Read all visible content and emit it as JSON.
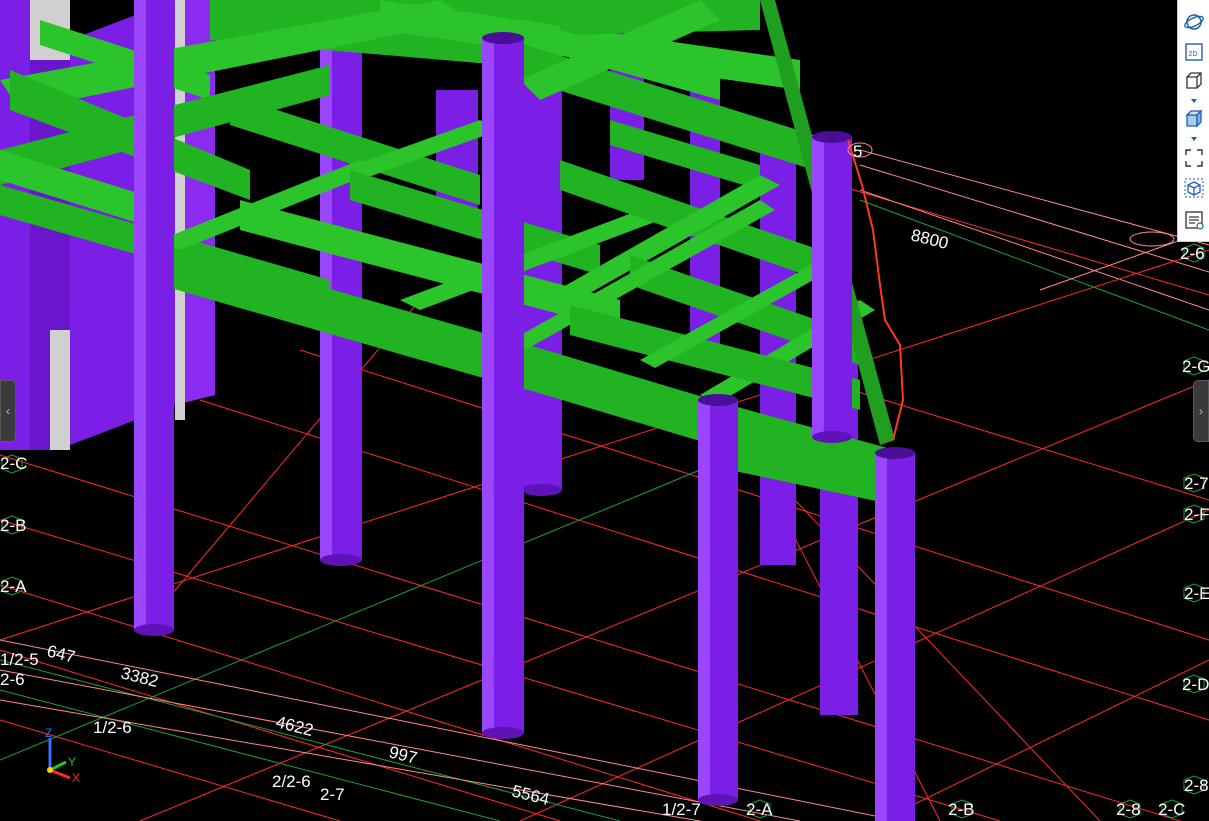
{
  "viewport": {
    "colors": {
      "background": "#000000",
      "column": "#7b1ee6",
      "beam": "#22b322",
      "grid_red": "#ff2a2a",
      "grid_green": "#1f9e3a",
      "grid_pink": "#ff8a8a",
      "measure_line": "#ff3a1a"
    },
    "grid_labels": {
      "l1": "2-6",
      "l2": "2-G",
      "l3": "2-7",
      "l4": "2-F",
      "l5": "2-E",
      "l6": "2-D",
      "l7": "2-8",
      "l8": "2-C",
      "l9": "2-B",
      "l10": "2-A",
      "l11": "1/2-5",
      "l12": "2-6",
      "l13": "1/2-6",
      "l14": "2/2-6",
      "l15": "2-7",
      "l16": "1/2-7",
      "l17": "2-A",
      "l18": "2-B",
      "l19": "2-8",
      "l20": "2-C",
      "l21": "5"
    },
    "dimensions": {
      "d1": "8800",
      "d2": "647",
      "d3": "3382",
      "d4": "4622",
      "d5": "997",
      "d6": "5564"
    },
    "axis": {
      "x": "X",
      "y": "Y",
      "z": "Z"
    }
  },
  "toolbar": {
    "buttons": [
      {
        "id": "orbit",
        "icon": "orbit-icon"
      },
      {
        "id": "2d",
        "icon": "2d-view-icon",
        "label": "2D"
      },
      {
        "id": "3d-box",
        "icon": "3d-box-icon"
      },
      {
        "id": "shaded-box",
        "icon": "shaded-box-icon"
      },
      {
        "id": "fit",
        "icon": "fit-view-icon"
      },
      {
        "id": "section-box",
        "icon": "section-box-icon"
      },
      {
        "id": "properties",
        "icon": "properties-icon"
      }
    ]
  }
}
